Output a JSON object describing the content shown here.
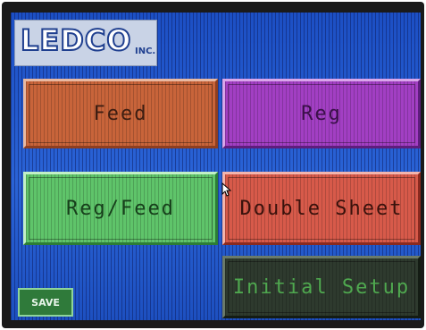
{
  "logo": {
    "brand": "LEDCO",
    "suffix": "INC."
  },
  "buttons": {
    "feed": "Feed",
    "reg": "Reg",
    "reg_feed": "Reg/Feed",
    "double_sheet": "Double Sheet",
    "initial_setup": "Initial Setup",
    "save": "SAVE"
  },
  "colors": {
    "screen_background": "#1f56c8",
    "feed": "#c8643a",
    "reg": "#a23fc3",
    "reg_feed": "#5fc46a",
    "double_sheet": "#d75a4a",
    "initial_setup": "#2e3a2e",
    "save": "#2f7a3a"
  },
  "icons": {
    "pointer": "mouse-pointer-icon"
  }
}
